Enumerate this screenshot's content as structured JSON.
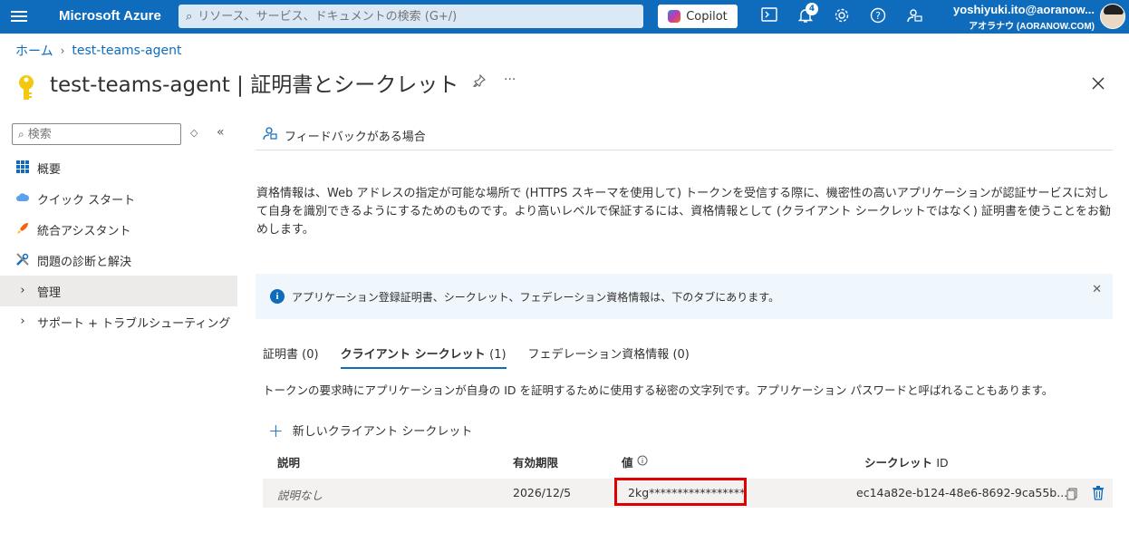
{
  "topbar": {
    "brand": "Microsoft Azure",
    "search_placeholder": "リソース、サービス、ドキュメントの検索 (G+/)",
    "copilot_label": "Copilot",
    "notification_count": "4",
    "user_email": "yoshiyuki.ito@aoranow...",
    "user_tenant": "アオラナウ (AORANOW.COM)"
  },
  "breadcrumb": {
    "home": "ホーム",
    "app": "test-teams-agent"
  },
  "page": {
    "title": "test-teams-agent | 証明書とシークレット",
    "more": "···"
  },
  "sidebar": {
    "search_placeholder": "検索",
    "items": [
      {
        "label": "概要"
      },
      {
        "label": "クイック スタート"
      },
      {
        "label": "統合アシスタント"
      },
      {
        "label": "問題の診断と解決"
      },
      {
        "label": "管理"
      },
      {
        "label": "サポート + トラブルシューティング"
      }
    ]
  },
  "content": {
    "feedback": "フィードバックがある場合",
    "description": "資格情報は、Web アドレスの指定が可能な場所で (HTTPS スキーマを使用して) トークンを受信する際に、機密性の高いアプリケーションが認証サービスに対して自身を識別できるようにするためのものです。より高いレベルで保証するには、資格情報として (クライアント シークレットではなく) 証明書を使うことをお勧めします。",
    "info_banner": "アプリケーション登録証明書、シークレット、フェデレーション資格情報は、下のタブにあります。",
    "tabs": [
      {
        "label": "証明書",
        "count": "(0)"
      },
      {
        "label": "クライアント シークレット",
        "count": "(1)"
      },
      {
        "label": "フェデレーション資格情報",
        "count": "(0)"
      }
    ],
    "tab_description": "トークンの要求時にアプリケーションが自身の ID を証明するために使用する秘密の文字列です。アプリケーション パスワードと呼ばれることもあります。",
    "new_secret": "新しいクライアント シークレット",
    "table": {
      "headers": {
        "description": "説明",
        "expires": "有効期限",
        "value": "値",
        "secret_id_a": "シークレット",
        "secret_id_b": "ID"
      },
      "rows": [
        {
          "description": "説明なし",
          "expires": "2026/12/5",
          "value": "2kg*****************",
          "secret_id": "ec14a82e-b124-48e6-8692-9ca55b..."
        }
      ]
    }
  },
  "colors": {
    "accent": "#0f6cbd",
    "highlight": "#e00000"
  }
}
